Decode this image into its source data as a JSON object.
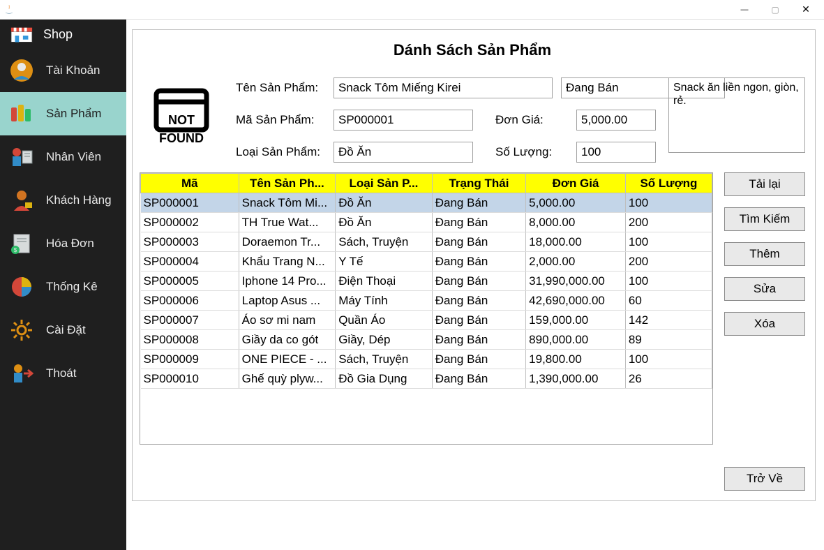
{
  "header": {
    "shop_label": "Shop"
  },
  "sidebar": {
    "items": [
      {
        "label": "Tài Khoản"
      },
      {
        "label": "Sản Phẩm"
      },
      {
        "label": "Nhân Viên"
      },
      {
        "label": "Khách Hàng"
      },
      {
        "label": "Hóa Đơn"
      },
      {
        "label": "Thống Kê"
      },
      {
        "label": "Cài Đặt"
      },
      {
        "label": "Thoát"
      }
    ]
  },
  "main": {
    "title": "Dánh Sách Sản Phẩm",
    "labels": {
      "ten": "Tên Sản Phẩm:",
      "ma": "Mã Sản Phẩm:",
      "loai": "Loại Sản Phẩm:",
      "dongia": "Đơn Giá:",
      "soluong": "Số Lượng:"
    },
    "form": {
      "ten": "Snack Tôm Miếng Kirei",
      "status": "Đang Bán",
      "ma": "SP000001",
      "loai": "Đồ Ăn",
      "dongia": "5,000.00",
      "soluong": "100",
      "desc": "Snack ăn liền ngon, giòn, rẻ."
    },
    "image_placeholder": "NOT FOUND",
    "columns": [
      "Mã",
      "Tên Sản Ph...",
      "Loại Sản P...",
      "Trạng Thái",
      "Đơn Giá",
      "Số Lượng"
    ],
    "rows": [
      {
        "ma": "SP000001",
        "ten": "Snack Tôm Mi...",
        "loai": "Đồ Ăn",
        "tt": "Đang Bán",
        "gia": "5,000.00",
        "sl": "100"
      },
      {
        "ma": "SP000002",
        "ten": " TH True Wat...",
        "loai": "Đồ Ăn",
        "tt": "Đang Bán",
        "gia": "8,000.00",
        "sl": "200"
      },
      {
        "ma": "SP000003",
        "ten": "Doraemon Tr...",
        "loai": "Sách, Truyện",
        "tt": "Đang Bán",
        "gia": "18,000.00",
        "sl": "100"
      },
      {
        "ma": "SP000004",
        "ten": "Khẩu Trang N...",
        "loai": "Y Tế",
        "tt": "Đang Bán",
        "gia": "2,000.00",
        "sl": "200"
      },
      {
        "ma": "SP000005",
        "ten": "Iphone 14 Pro...",
        "loai": "Điện Thoại",
        "tt": "Đang Bán",
        "gia": "31,990,000.00",
        "sl": "100"
      },
      {
        "ma": "SP000006",
        "ten": "Laptop Asus ...",
        "loai": "Máy Tính",
        "tt": "Đang Bán",
        "gia": "42,690,000.00",
        "sl": "60"
      },
      {
        "ma": "SP000007",
        "ten": "Áo sơ mi nam",
        "loai": "Quần Áo",
        "tt": "Đang Bán",
        "gia": "159,000.00",
        "sl": "142"
      },
      {
        "ma": "SP000008",
        "ten": "Giầy da co gót",
        "loai": "Giầy, Dép",
        "tt": "Đang Bán",
        "gia": "890,000.00",
        "sl": "89"
      },
      {
        "ma": "SP000009",
        "ten": "ONE PIECE - ...",
        "loai": "Sách, Truyện",
        "tt": "Đang Bán",
        "gia": "19,800.00",
        "sl": "100"
      },
      {
        "ma": "SP000010",
        "ten": "Ghế quỳ plyw...",
        "loai": "Đồ Gia Dụng",
        "tt": "Đang Bán",
        "gia": "1,390,000.00",
        "sl": "26"
      }
    ],
    "buttons": {
      "reload": "Tải lại",
      "search": "Tìm Kiếm",
      "add": "Thêm",
      "edit": "Sửa",
      "delete": "Xóa",
      "back": "Trở Về"
    }
  }
}
